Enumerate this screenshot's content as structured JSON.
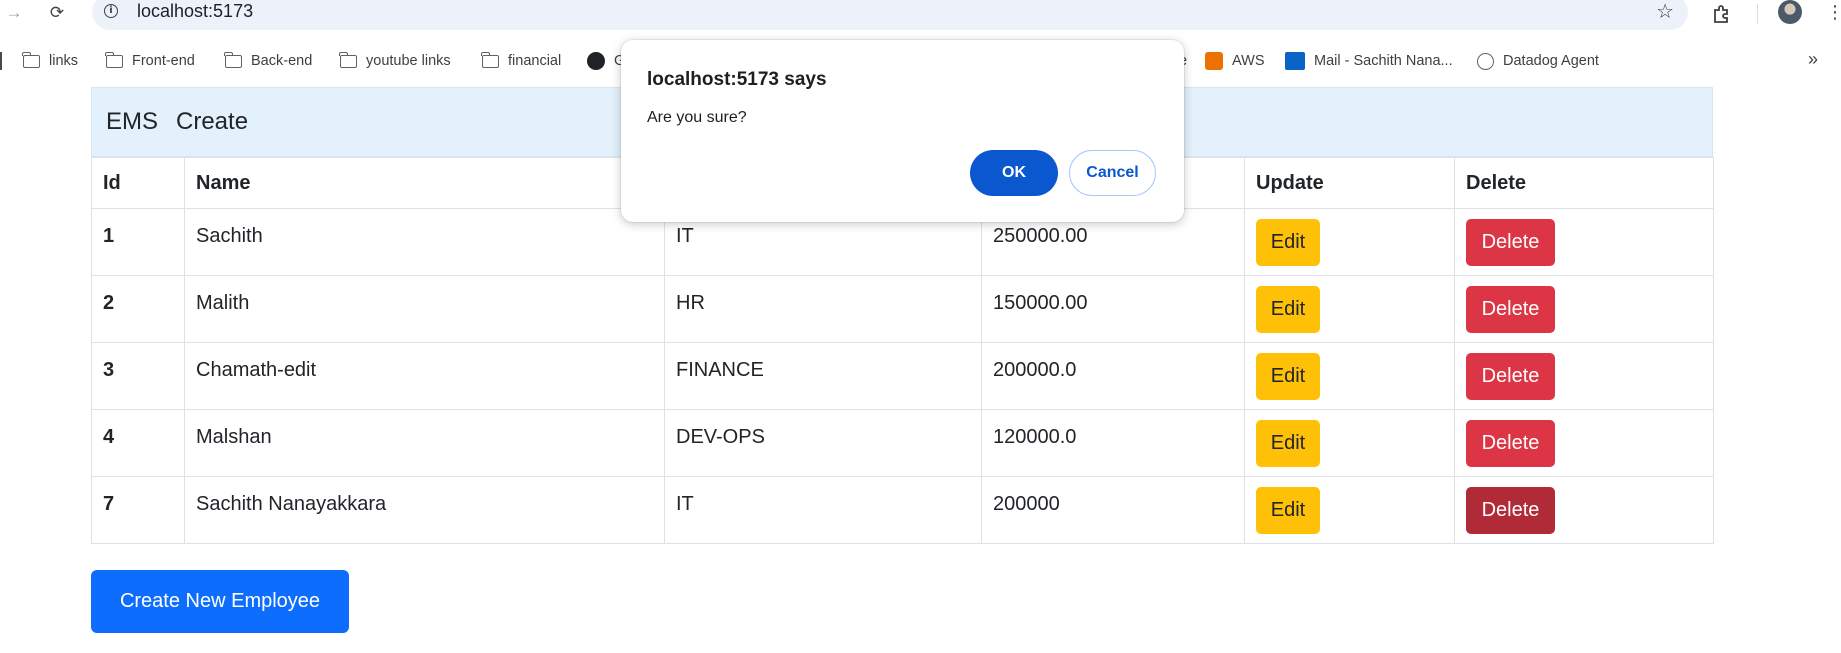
{
  "browser": {
    "url": "localhost:5173",
    "bookmarks": [
      {
        "label": "links",
        "icon": "folder-icon"
      },
      {
        "label": "Front-end",
        "icon": "folder-icon"
      },
      {
        "label": "Back-end",
        "icon": "folder-icon"
      },
      {
        "label": "youtube links",
        "icon": "folder-icon"
      },
      {
        "label": "financial",
        "icon": "folder-icon"
      },
      {
        "label": "G",
        "icon": "github-icon"
      },
      {
        "label": "e",
        "icon": ""
      },
      {
        "label": "AWS",
        "icon": "aws-icon"
      },
      {
        "label": "Mail - Sachith Nana...",
        "icon": "outlook-icon"
      },
      {
        "label": "Datadog Agent",
        "icon": "globe-icon"
      }
    ]
  },
  "app": {
    "brand": "EMS",
    "nav_create": "Create",
    "table": {
      "headers": {
        "id": "Id",
        "name": "Name",
        "update": "Update",
        "delete": "Delete"
      },
      "rows": [
        {
          "id": "1",
          "name": "Sachith",
          "department": "IT",
          "salary": "250000.00"
        },
        {
          "id": "2",
          "name": "Malith",
          "department": "HR",
          "salary": "150000.00"
        },
        {
          "id": "3",
          "name": "Chamath-edit",
          "department": "FINANCE",
          "salary": "200000.0"
        },
        {
          "id": "4",
          "name": "Malshan",
          "department": "DEV-OPS",
          "salary": "120000.0"
        },
        {
          "id": "7",
          "name": "Sachith Nanayakkara",
          "department": "IT",
          "salary": "200000"
        }
      ],
      "edit_label": "Edit",
      "delete_label": "Delete"
    },
    "create_button": "Create New Employee"
  },
  "dialog": {
    "title": "localhost:5173 says",
    "message": "Are you sure?",
    "ok_label": "OK",
    "cancel_label": "Cancel"
  },
  "colors": {
    "navbar_bg": "#e3f1fc",
    "primary": "#0d6efd",
    "warning": "#ffc107",
    "danger": "#dc3545",
    "danger_active": "#b02a37",
    "dialog_ok": "#0b57d0"
  }
}
